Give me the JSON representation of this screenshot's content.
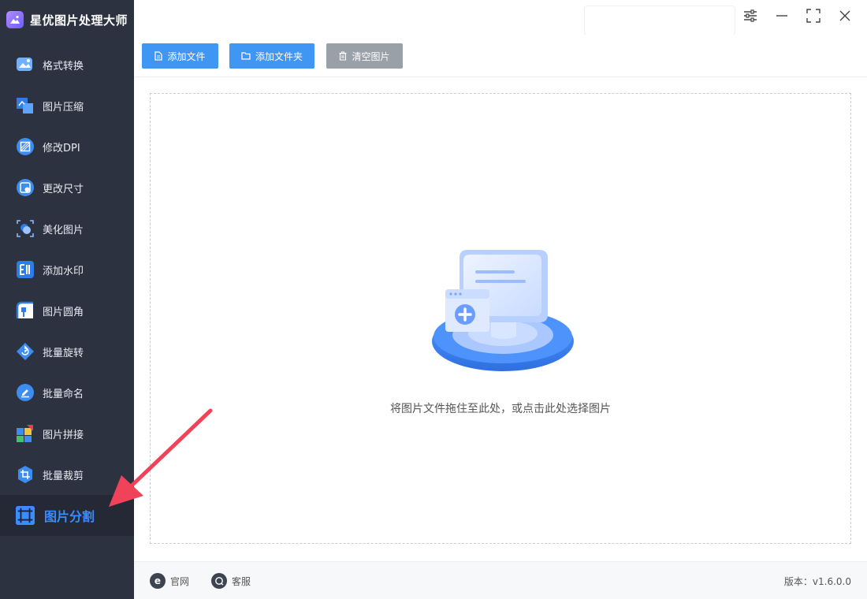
{
  "app": {
    "title": "星优图片处理大师",
    "logo_icon": "image-logo-icon"
  },
  "sidebar": {
    "items": [
      {
        "label": "格式转换",
        "icon": "format-convert-icon"
      },
      {
        "label": "图片压缩",
        "icon": "compress-icon"
      },
      {
        "label": "修改DPI",
        "icon": "dpi-icon"
      },
      {
        "label": "更改尺寸",
        "icon": "resize-icon"
      },
      {
        "label": "美化图片",
        "icon": "beautify-icon"
      },
      {
        "label": "添加水印",
        "icon": "watermark-icon"
      },
      {
        "label": "图片圆角",
        "icon": "round-corner-icon"
      },
      {
        "label": "批量旋转",
        "icon": "rotate-icon"
      },
      {
        "label": "批量命名",
        "icon": "rename-icon"
      },
      {
        "label": "图片拼接",
        "icon": "stitch-icon"
      },
      {
        "label": "批量裁剪",
        "icon": "crop-icon"
      },
      {
        "label": "图片分割",
        "icon": "split-icon",
        "active": true
      }
    ]
  },
  "toolbar": {
    "add_file": "添加文件",
    "add_folder": "添加文件夹",
    "clear": "清空图片"
  },
  "dropzone": {
    "hint": "将图片文件拖住至此处，或点击此处选择图片"
  },
  "footer": {
    "website": "官网",
    "website_icon_text": "e",
    "support": "客服",
    "version": "版本：v1.6.0.0"
  },
  "colors": {
    "accent": "#3f96f5",
    "sidebar_bg": "#2c3240",
    "active_text": "#3b8cff",
    "arrow": "#f0435a"
  }
}
